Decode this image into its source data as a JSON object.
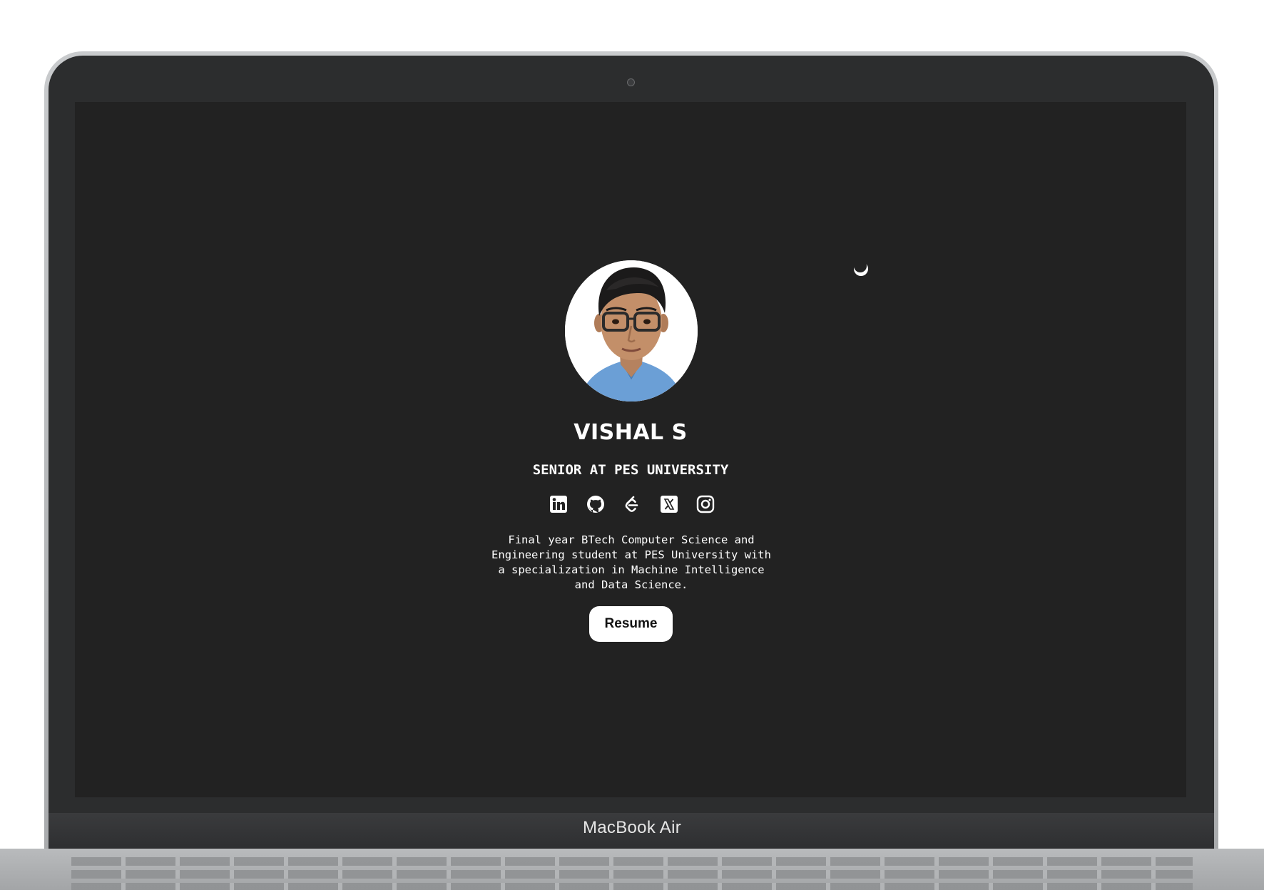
{
  "device": {
    "label": "MacBook Air"
  },
  "page": {
    "theme_toggle_icon": "moon-icon",
    "name": "VISHAL S",
    "subtitle": "SENIOR AT PES UNIVERSITY",
    "socials": [
      {
        "icon": "linkedin-icon"
      },
      {
        "icon": "github-icon"
      },
      {
        "icon": "leetcode-icon"
      },
      {
        "icon": "x-twitter-icon"
      },
      {
        "icon": "instagram-icon"
      }
    ],
    "bio": "Final year BTech Computer Science and Engineering student at PES University with a specialization in Machine Intelligence and Data Science.",
    "resume_label": "Resume"
  },
  "colors": {
    "background": "#222222",
    "text": "#ffffff",
    "button_bg": "#ffffff",
    "button_text": "#111111",
    "shirt": "#6b9fd6"
  }
}
